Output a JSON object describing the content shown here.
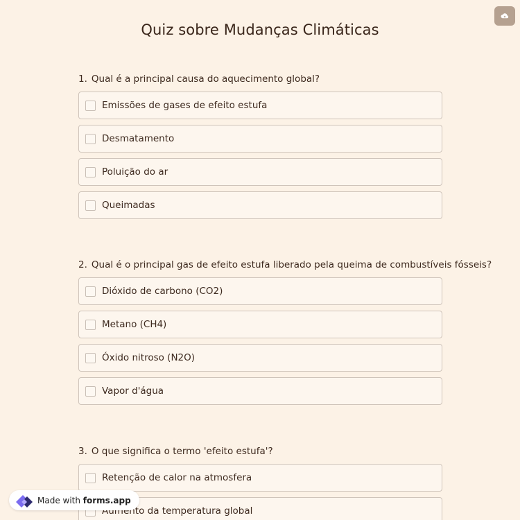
{
  "form": {
    "title": "Quiz sobre Mudanças Climáticas",
    "save_icon": "cloud-upload-icon"
  },
  "questions": [
    {
      "number": "1.",
      "text": "Qual é a principal causa do aquecimento global?",
      "options": [
        "Emissões de gases de efeito estufa",
        "Desmatamento",
        "Poluição do ar",
        "Queimadas"
      ]
    },
    {
      "number": "2.",
      "text": "Qual é o principal gas de efeito estufa liberado pela queima de combustíveis fósseis?",
      "options": [
        "Dióxido de carbono (CO2)",
        "Metano (CH4)",
        "Óxido nitroso (N2O)",
        "Vapor d'água"
      ]
    },
    {
      "number": "3.",
      "text": "O que significa o termo 'efeito estufa'?",
      "options": [
        "Retenção de calor na atmosfera",
        "Aumento da temperatura global"
      ]
    }
  ],
  "badge": {
    "prefix": "Made with ",
    "brand": "forms.app",
    "icon": "forms-app-logo-icon"
  },
  "colors": {
    "background": "#fcf2e6",
    "save_button": "#b5a190",
    "text": "#3e2a1f",
    "option_border": "#cfc4ba",
    "logo_purple": "#6c5ce7",
    "logo_dark": "#2d2a6e"
  }
}
